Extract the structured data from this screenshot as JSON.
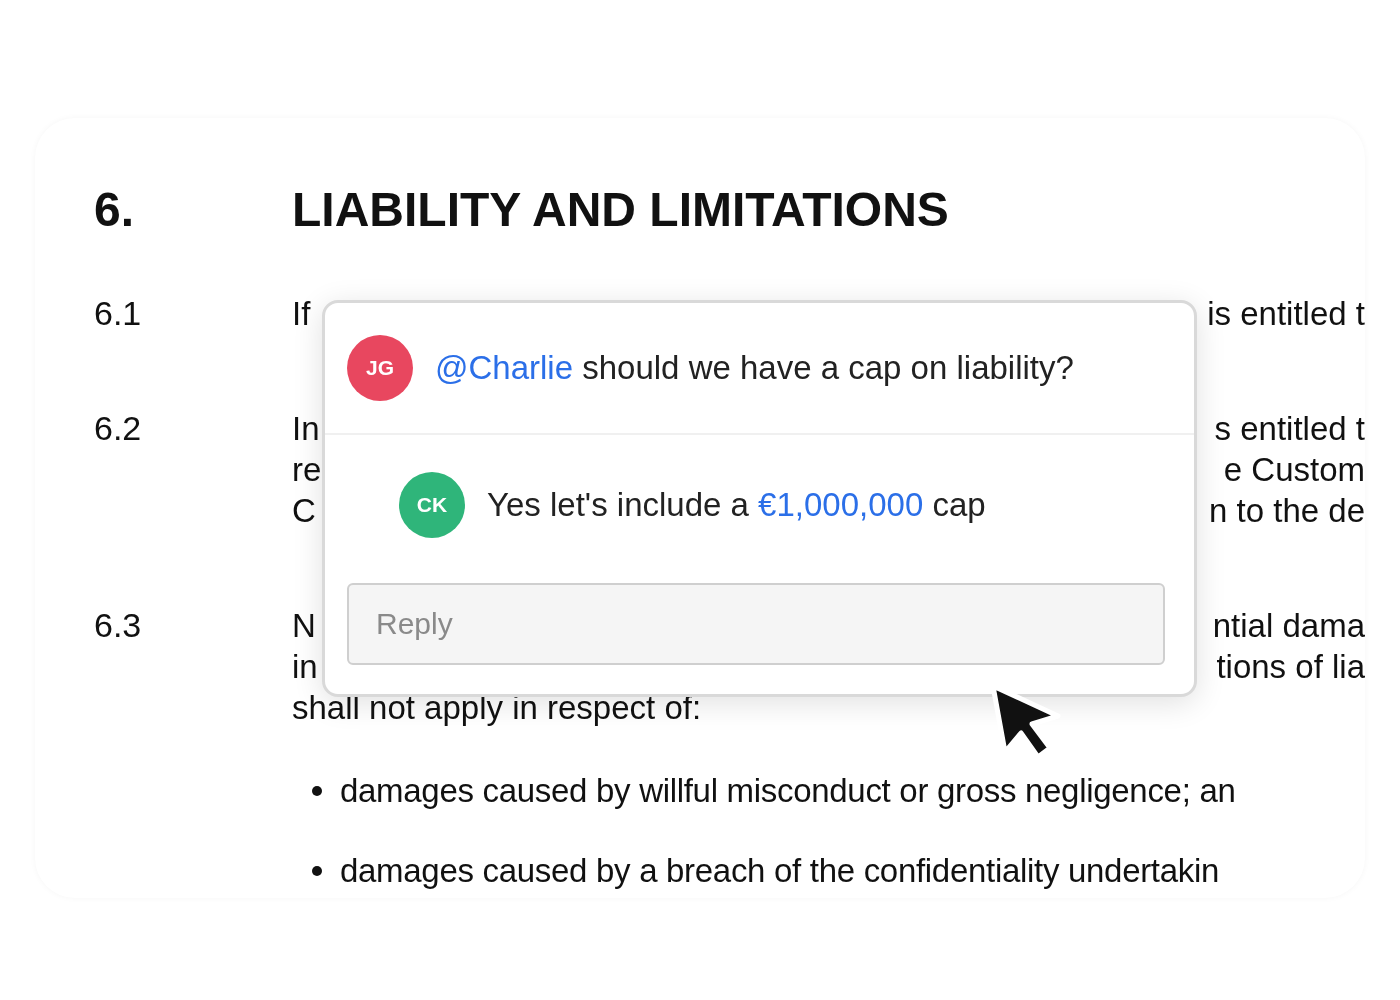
{
  "section": {
    "number": "6.",
    "title": "LIABILITY AND LIMITATIONS"
  },
  "clauses": [
    {
      "number": "6.1",
      "lines": [
        {
          "left": "If",
          "right": "is entitled t"
        }
      ]
    },
    {
      "number": "6.2",
      "lines": [
        {
          "left": "In",
          "right": "s entitled t"
        },
        {
          "left": "re",
          "right": "e Custom"
        },
        {
          "left": "C",
          "right": "n to the de"
        }
      ]
    },
    {
      "number": "6.3",
      "lines": [
        {
          "left": "N",
          "right": "ntial dama"
        },
        {
          "left": "in",
          "right": "tions of lia"
        },
        {
          "left": "shall not apply in respect of:"
        }
      ]
    }
  ],
  "bullets": [
    "damages caused by willful misconduct or gross negligence; an",
    "damages caused by a breach of the confidentiality undertakin"
  ],
  "comment_thread": {
    "comments": [
      {
        "kind": "comment",
        "initials": "JG",
        "color": "#e8475f",
        "parts": [
          {
            "kind": "mention",
            "text": "@Charlie"
          },
          {
            "kind": "plain",
            "text": " should we have a cap on liability?"
          }
        ]
      },
      {
        "kind": "reply",
        "initials": "CK",
        "color": "#2fb57a",
        "parts": [
          {
            "kind": "plain",
            "text": "Yes let's include a "
          },
          {
            "kind": "amount",
            "text": "€1,000,000"
          },
          {
            "kind": "plain",
            "text": " cap"
          }
        ]
      }
    ],
    "reply_field": {
      "placeholder": "Reply"
    }
  }
}
